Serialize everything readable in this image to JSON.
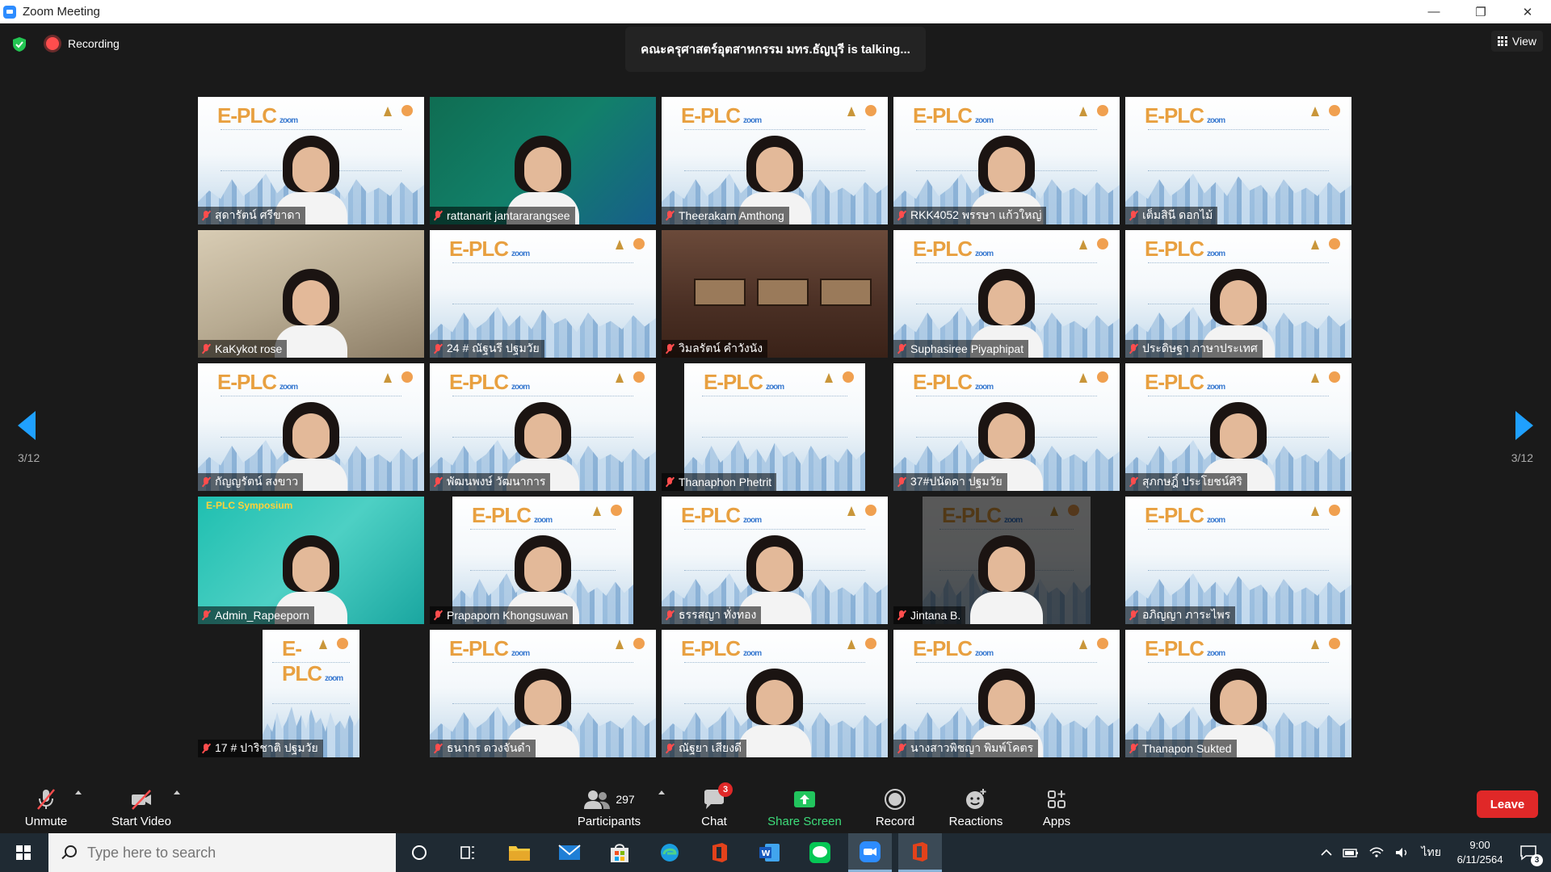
{
  "window": {
    "title": "Zoom Meeting",
    "minimize": "—",
    "restore": "❐",
    "close": "✕"
  },
  "meeting": {
    "recording_label": "Recording",
    "talking": "คณะครุศาสตร์อุตสาหกรรม มทร.ธัญบุรี is  talking...",
    "view_label": "View",
    "page_left": "3/12",
    "page_right": "3/12"
  },
  "participants": [
    {
      "name": "สุดารัตน์ ศรีขาดา",
      "bg": "plc"
    },
    {
      "name": "rattanarit jantararangsee",
      "bg": "green"
    },
    {
      "name": "Theerakarn Amthong",
      "bg": "plc"
    },
    {
      "name": "RKK4052 พรรษา แก้วใหญ่",
      "bg": "plc"
    },
    {
      "name": "เต็มสินี ดอกไม้",
      "bg": "plc"
    },
    {
      "name": "KaKykot rose",
      "bg": "room"
    },
    {
      "name": "24 # ณัฐนรี ปฐมวัย",
      "bg": "plc"
    },
    {
      "name": "วิมลรัตน์ คำวังนัง",
      "bg": "wood"
    },
    {
      "name": "Suphasiree Piyaphipat",
      "bg": "plc"
    },
    {
      "name": "ประดิษฐา ภาษาประเทศ",
      "bg": "plc"
    },
    {
      "name": "กัญญรัตน์ สงขาว",
      "bg": "plc"
    },
    {
      "name": "พัฒนพงษ์ วัฒนาการ",
      "bg": "plc"
    },
    {
      "name": "Thanaphon Phetrit",
      "bg": "plc-narrow"
    },
    {
      "name": "37#ปนัดดา ปฐมวัย",
      "bg": "plc"
    },
    {
      "name": "สุภกษฎิ์ ประโยชน์ศิริ",
      "bg": "plc"
    },
    {
      "name": "Admin_Rapeeporn",
      "bg": "teal"
    },
    {
      "name": "Prapaporn Khongsuwan",
      "bg": "plc-narrow"
    },
    {
      "name": "ธรรสญา ทั่งทอง",
      "bg": "plc"
    },
    {
      "name": "Jintana B.",
      "bg": "dark-narrow"
    },
    {
      "name": "อภิญญา ภาระไพร",
      "bg": "plc"
    },
    {
      "name": "17 # ปาริชาติ ปฐมวัย",
      "bg": "plc-small"
    },
    {
      "name": "ธนากร ดวงจันดำ",
      "bg": "plc"
    },
    {
      "name": "ณัฐยา เสียงดี",
      "bg": "plc"
    },
    {
      "name": "นางสาวพิชญา พิมพ์โคตร",
      "bg": "plc"
    },
    {
      "name": "Thanapon Sukted",
      "bg": "plc"
    }
  ],
  "tile_texts": {
    "plc_logo": "E-PLC",
    "plc_zoom": "zoom",
    "teal_head": "E-PLC Symposium"
  },
  "toolbar": {
    "unmute": "Unmute",
    "start_video": "Start Video",
    "participants": "Participants",
    "participant_count": "297",
    "chat": "Chat",
    "chat_badge": "3",
    "share": "Share Screen",
    "record": "Record",
    "reactions": "Reactions",
    "apps": "Apps",
    "leave": "Leave"
  },
  "taskbar": {
    "search_placeholder": "Type here to search",
    "lang": "ไทย",
    "time": "9:00",
    "date": "6/11/2564",
    "notif_count": "3"
  },
  "colors": {
    "accent": "#2d8cff",
    "leave": "#e02828",
    "share": "#22c55e",
    "nav": "#1fa0ff"
  }
}
